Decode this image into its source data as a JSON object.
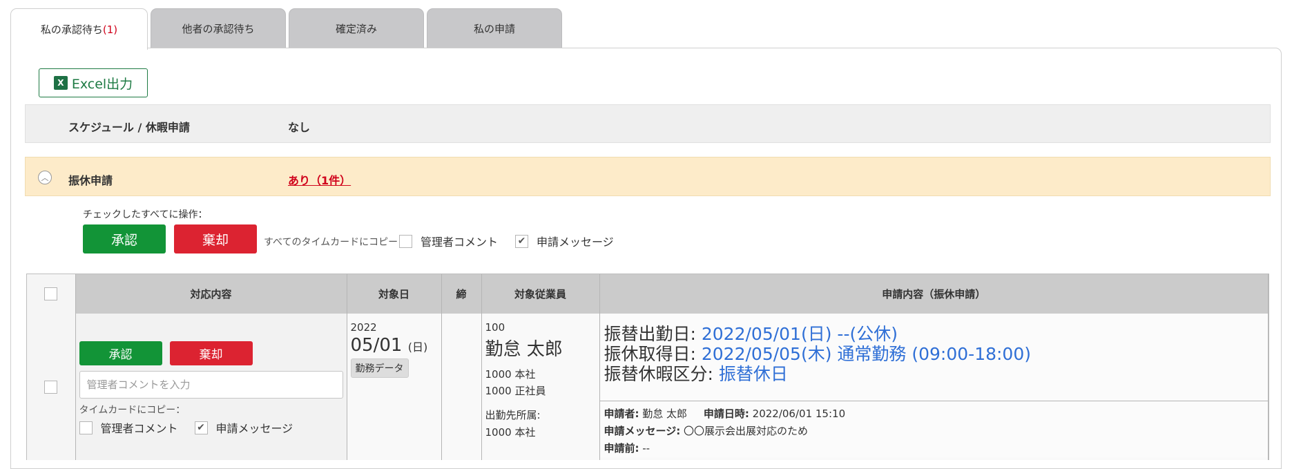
{
  "tabs": [
    {
      "label": "私の承認待ち",
      "count": "(1)"
    },
    {
      "label": "他者の承認待ち"
    },
    {
      "label": "確定済み"
    },
    {
      "label": "私の申請"
    }
  ],
  "toolbar": {
    "excel_label": "Excel出力",
    "excel_icon": "X"
  },
  "schedule_row": {
    "label": "スケジュール / 休暇申請",
    "value": "なし"
  },
  "furikyu_row": {
    "label": "振休申請",
    "value": "あり（1件）",
    "collapse_icon": "︿"
  },
  "bulk": {
    "label": "チェックしたすべてに操作：",
    "approve": "承認",
    "reject": "棄却",
    "copy_label": "すべてのタイムカードにコピー：",
    "opt_admin_comment": "管理者コメント",
    "opt_request_message": "申請メッセージ",
    "check_mark": "✔"
  },
  "table": {
    "headers": [
      "対応内容",
      "対象日",
      "締",
      "対象従業員",
      "申請内容（振休申請）"
    ],
    "row": {
      "approve": "承認",
      "reject": "棄却",
      "comment_placeholder": "管理者コメントを入力",
      "copy_label": "タイムカードにコピー：",
      "opt_admin_comment": "管理者コメント",
      "opt_request_message": "申請メッセージ",
      "check_mark": "✔",
      "year": "2022",
      "month_day": "05/01",
      "dow": "(日)",
      "work_data": "勤務データ",
      "emp_id": "100",
      "emp_name": "勤怠 太郎",
      "dept1": "1000 本社",
      "dept2": "1000 正社員",
      "place_label": "出勤先所属:",
      "place": "1000  本社",
      "work_date_label": "振替出勤日: ",
      "work_date_value": "2022/05/01(日) --(公休)",
      "off_date_label": "振休取得日: ",
      "off_date_value": "2022/05/05(木) 通常勤務 (09:00-18:00)",
      "kind_label": "振替休暇区分: ",
      "kind_value": "振替休日",
      "applicant_label": "申請者:",
      "applicant": " 勤怠 太郎",
      "applied_at_label": "申請日時:",
      "applied_at": " 2022/06/01 15:10",
      "message_label": "申請メッセージ:",
      "message": " 〇〇展示会出展対応のため",
      "before_label": "申請前:",
      "before": " --"
    }
  }
}
